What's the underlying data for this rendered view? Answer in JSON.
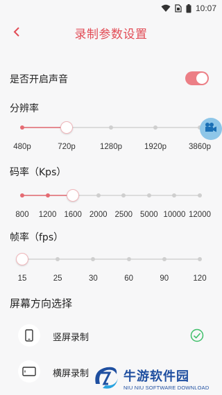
{
  "status_bar": {
    "time": "10:07",
    "icons": [
      "wifi-icon",
      "sim-icon",
      "battery-icon"
    ]
  },
  "header": {
    "title": "录制参数设置",
    "back_icon": "chevron-left-icon"
  },
  "sound": {
    "label": "是否开启声音",
    "enabled": true
  },
  "resolution": {
    "label": "分辨率",
    "options": [
      "480p",
      "720p",
      "1280p",
      "1920p",
      "3860p"
    ],
    "selected": "720p"
  },
  "bitrate": {
    "label": "码率（Kps）",
    "options": [
      "800",
      "1200",
      "1600",
      "2000",
      "2500",
      "5000",
      "10000",
      "12000"
    ],
    "selected": "1600"
  },
  "framerate": {
    "label": "帧率（fps）",
    "options": [
      "15",
      "25",
      "30",
      "60",
      "90",
      "120"
    ],
    "selected": "15"
  },
  "orientation": {
    "title": "屏幕方向选择",
    "options": [
      {
        "label": "竖屏录制",
        "icon": "portrait-phone-icon",
        "selected": true
      },
      {
        "label": "横屏录制",
        "icon": "landscape-phone-icon",
        "selected": false
      }
    ]
  },
  "floating_button": {
    "icon": "video-camera-icon"
  },
  "watermark": {
    "name": "牛游软件园",
    "subtitle": "NIU NIU SOFTWARE DOWNLOAD"
  },
  "colors": {
    "accent": "#e24c56",
    "toggle": "#ec7f86",
    "slider_fill": "#e58a90",
    "check": "#3fbf6a"
  }
}
